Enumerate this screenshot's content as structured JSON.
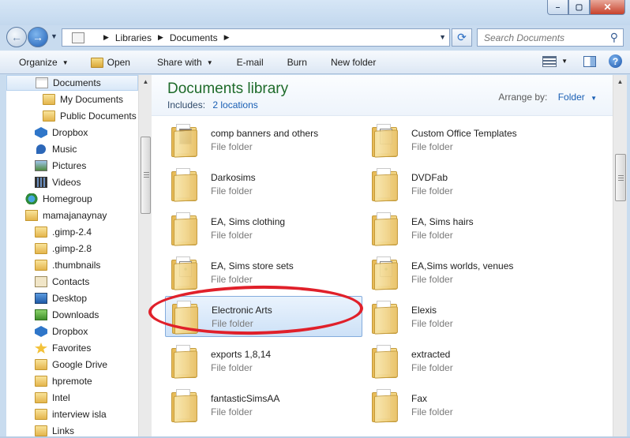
{
  "window": {
    "minimize": "–",
    "maximize": "▢",
    "close": "✕"
  },
  "address_bar": {
    "crumbs": [
      "Libraries",
      "Documents"
    ],
    "search_placeholder": "Search Documents"
  },
  "toolbar": {
    "organize": "Organize",
    "open": "Open",
    "share_with": "Share with",
    "email": "E-mail",
    "burn": "Burn",
    "new_folder": "New folder",
    "help": "?"
  },
  "nav_pane": {
    "items": [
      {
        "label": "Documents",
        "icon": "documents-icon",
        "selected": true
      },
      {
        "label": "My Documents",
        "icon": "folder-icon"
      },
      {
        "label": "Public Documents",
        "icon": "folder-icon"
      },
      {
        "label": "Dropbox",
        "icon": "dropbox-icon"
      },
      {
        "label": "Music",
        "icon": "music-icon"
      },
      {
        "label": "Pictures",
        "icon": "pictures-icon"
      },
      {
        "label": "Videos",
        "icon": "videos-icon"
      },
      {
        "label": "Homegroup",
        "icon": "homegroup-icon"
      },
      {
        "label": "mamajanaynay",
        "icon": "user-folder-icon"
      },
      {
        "label": ".gimp-2.4",
        "icon": "folder-icon"
      },
      {
        "label": ".gimp-2.8",
        "icon": "folder-icon"
      },
      {
        "label": ".thumbnails",
        "icon": "folder-icon"
      },
      {
        "label": "Contacts",
        "icon": "contacts-icon"
      },
      {
        "label": "Desktop",
        "icon": "desktop-icon"
      },
      {
        "label": "Downloads",
        "icon": "downloads-icon"
      },
      {
        "label": "Dropbox",
        "icon": "dropbox-icon"
      },
      {
        "label": "Favorites",
        "icon": "favorites-icon"
      },
      {
        "label": "Google Drive",
        "icon": "folder-icon"
      },
      {
        "label": "hpremote",
        "icon": "folder-icon"
      },
      {
        "label": "Intel",
        "icon": "folder-icon"
      },
      {
        "label": "interview isla",
        "icon": "folder-icon"
      },
      {
        "label": "Links",
        "icon": "folder-icon"
      }
    ]
  },
  "library": {
    "title": "Documents library",
    "includes_label": "Includes:",
    "includes_link": "2 locations",
    "arrange_label": "Arrange by:",
    "arrange_value": "Folder"
  },
  "files": [
    {
      "name": "comp banners and others",
      "type": "File folder"
    },
    {
      "name": "Custom Office Templates",
      "type": "File folder"
    },
    {
      "name": "Darkosims",
      "type": "File folder"
    },
    {
      "name": "DVDFab",
      "type": "File folder"
    },
    {
      "name": "EA, Sims clothing",
      "type": "File folder"
    },
    {
      "name": "EA, Sims hairs",
      "type": "File folder"
    },
    {
      "name": "EA, Sims store sets",
      "type": "File folder"
    },
    {
      "name": "EA,Sims worlds, venues",
      "type": "File folder"
    },
    {
      "name": "Electronic Arts",
      "type": "File folder",
      "selected": true
    },
    {
      "name": "Elexis",
      "type": "File folder"
    },
    {
      "name": "exports 1,8,14",
      "type": "File folder"
    },
    {
      "name": "extracted",
      "type": "File folder"
    },
    {
      "name": "fantasticSimsAA",
      "type": "File folder"
    },
    {
      "name": "Fax",
      "type": "File folder"
    }
  ],
  "colors": {
    "title_green": "#1e6b2a",
    "link_blue": "#1a5fb4",
    "annotation_red": "#e0202a"
  }
}
